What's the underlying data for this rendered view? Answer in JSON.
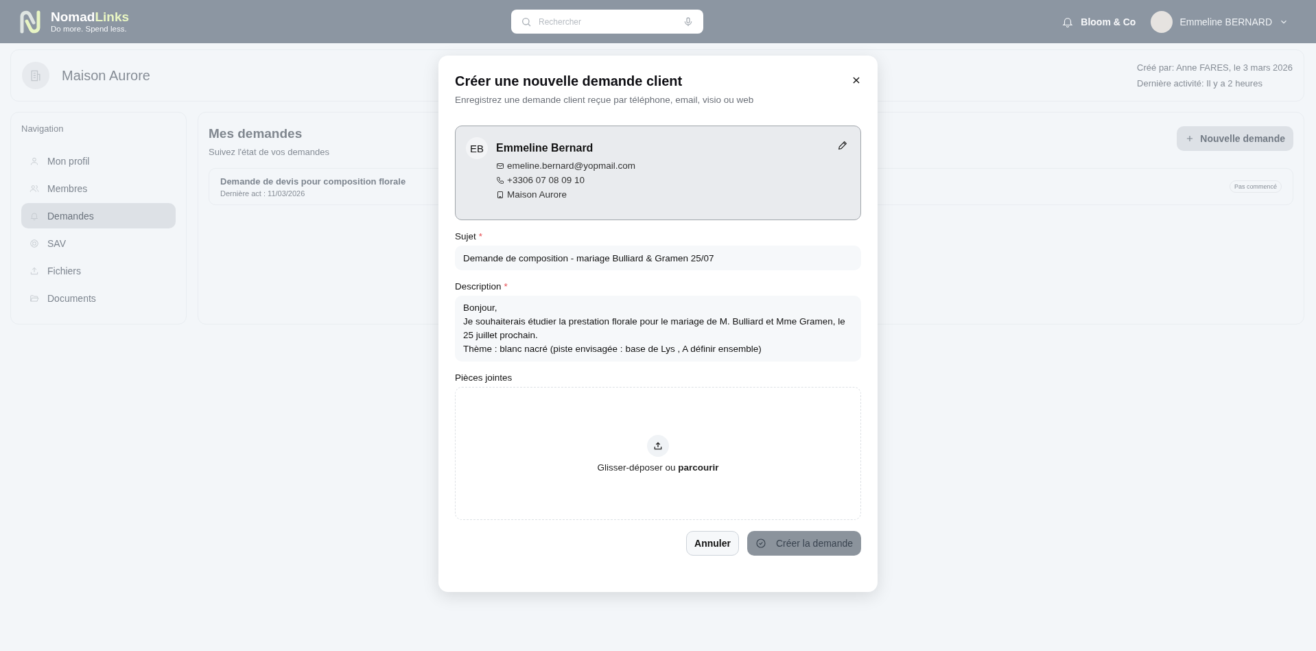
{
  "topbar": {
    "brand_first": "Nomad",
    "brand_second": "Links",
    "tagline": "Do more. Spend less.",
    "search": {
      "placeholder": "Rechercher"
    },
    "organization": "Bloom & Co",
    "user_name": "Emmeline BERNARD"
  },
  "header": {
    "title": "Maison Aurore",
    "created": "Créé par: Anne FARES, le 3 mars 2026",
    "activity": "Dernière activité: Il y a 2 heures"
  },
  "sidebar": {
    "heading": "Navigation",
    "items": [
      {
        "label": "Mon profil",
        "selected": false
      },
      {
        "label": "Membres",
        "selected": false
      },
      {
        "label": "Demandes",
        "selected": true
      },
      {
        "label": "SAV",
        "selected": false
      },
      {
        "label": "Fichiers",
        "selected": false
      },
      {
        "label": "Documents",
        "selected": false
      }
    ]
  },
  "main": {
    "title": "Mes demandes",
    "subtitle": "Suivez l'état de vos demandes",
    "new_button": "Nouvelle demande",
    "requests": [
      {
        "title": "Demande de devis pour composition florale",
        "last_activity": "Dernière act : 11/03/2026",
        "status": "Pas commencé"
      }
    ]
  },
  "modal": {
    "title": "Créer une nouvelle demande client",
    "subtitle": "Enregistrez une demande client reçue par téléphone, email, visio ou web",
    "client": {
      "initials": "EB",
      "name": "Emmeline Bernard",
      "email": "emeline.bernard@yopmail.com",
      "phone": "+3306 07 08 09 10",
      "company": "Maison Aurore"
    },
    "subject": {
      "label": "Sujet",
      "required_mark": "*",
      "value": "Demande de composition - mariage Bulliard & Gramen 25/07"
    },
    "description": {
      "label": "Description",
      "required_mark": "*",
      "value": "Bonjour,\nJe souhaiterais étudier la prestation florale pour le mariage de M. Bulliard et Mme Gramen, le 25 juillet prochain.\nThème : blanc nacré (piste envisagée : base de Lys , A définir ensemble)"
    },
    "attachments": {
      "label": "Pièces jointes",
      "drop_text": "Glisser-déposer ou **parcourir**"
    },
    "cancel_button": "Annuler",
    "submit_button": {
      "label": "Créer la demande",
      "disabled": true
    }
  }
}
